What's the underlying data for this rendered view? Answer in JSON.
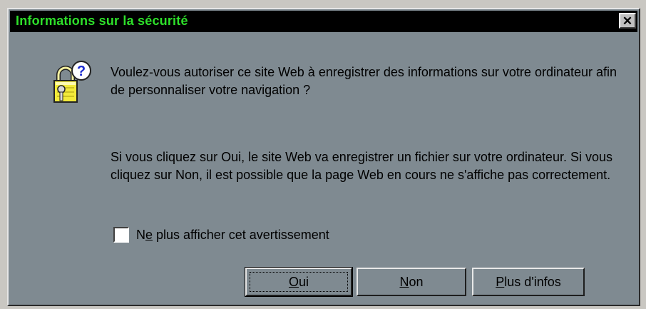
{
  "window": {
    "title": "Informations sur la sécurité",
    "close_glyph": "✕"
  },
  "body": {
    "question": "Voulez-vous autoriser ce site Web  à enregistrer des informations sur votre ordinateur afin de personnaliser votre navigation ?",
    "explanation": "Si vous cliquez sur Oui, le site Web va enregistrer un fichier sur votre ordinateur. Si vous cliquez sur Non, il est possible que la page Web en cours ne s'affiche pas correctement.",
    "checkbox": {
      "label_prefix": "N",
      "label_mnemonic": "e",
      "label_suffix": " plus afficher cet avertissement",
      "checked": false
    }
  },
  "buttons": {
    "oui": {
      "mnemonic": "O",
      "rest": "ui"
    },
    "non": {
      "mnemonic": "N",
      "rest": "on"
    },
    "plus": {
      "mnemonic": "P",
      "rest": "lus d'infos"
    }
  },
  "icons": {
    "security": "lock-question-icon",
    "close": "close-icon"
  },
  "colors": {
    "titlebar_bg": "#000000",
    "title_text": "#2ee02a",
    "dialog_bg": "#7f8a91"
  }
}
